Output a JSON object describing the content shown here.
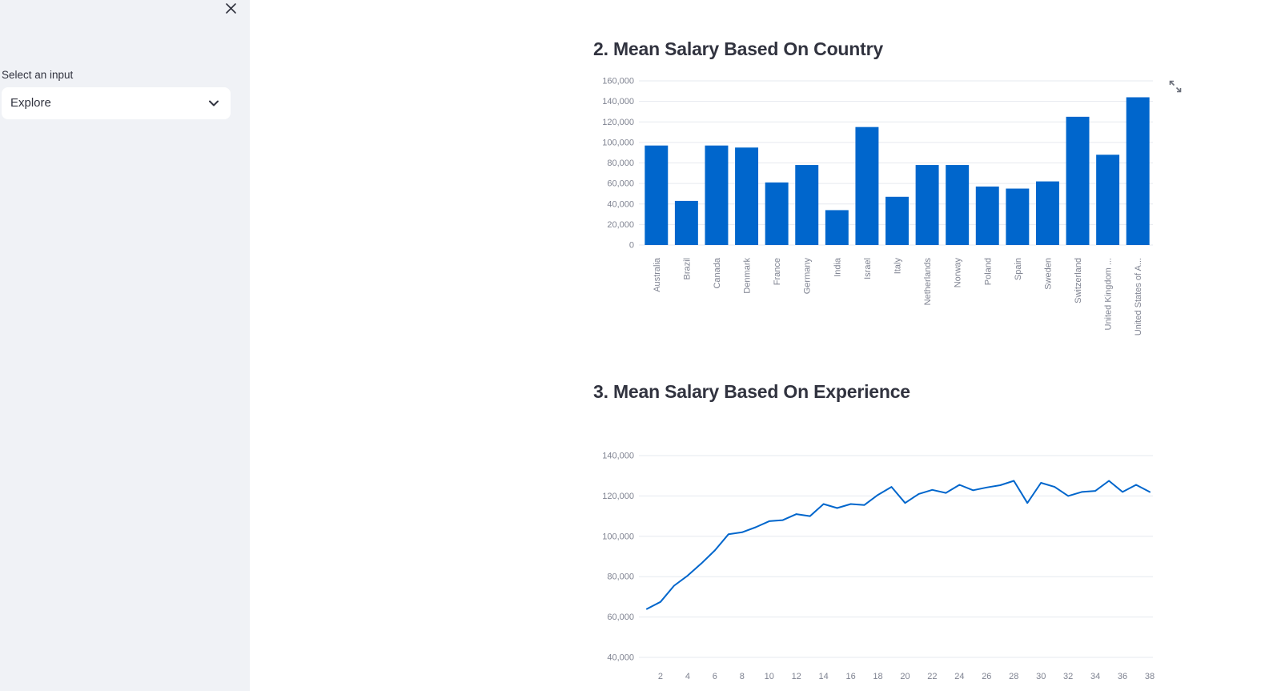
{
  "sidebar": {
    "select_label": "Select an input",
    "select_value": "Explore",
    "close_icon": "close-icon",
    "chevron_icon": "chevron-down-icon"
  },
  "main": {
    "headings": {
      "country": "2. Mean Salary Based On Country",
      "experience": "3. Mean Salary Based On Experience"
    },
    "expand_icon": "fullscreen-expand-icon"
  },
  "colors": {
    "bar": "#0066cc",
    "line": "#0066cc",
    "sidebar_bg": "#f0f2f6",
    "grid": "#e6e9ef",
    "axis_text": "#7f8391",
    "heading": "#31333f"
  },
  "chart_data": [
    {
      "type": "bar",
      "title": "2. Mean Salary Based On Country",
      "categories": [
        "Australia",
        "Brazil",
        "Canada",
        "Denmark",
        "France",
        "Germany",
        "India",
        "Israel",
        "Italy",
        "Netherlands",
        "Norway",
        "Poland",
        "Spain",
        "Sweden",
        "Switzerland",
        "United Kingdom ...",
        "United States of A..."
      ],
      "values": [
        97000,
        43000,
        97000,
        95000,
        61000,
        78000,
        34000,
        115000,
        47000,
        78000,
        78000,
        57000,
        55000,
        62000,
        125000,
        88000,
        144000
      ],
      "ylim": [
        0,
        160000
      ],
      "yticks": [
        0,
        20000,
        40000,
        60000,
        80000,
        100000,
        120000,
        140000,
        160000
      ],
      "ytick_labels": [
        "0",
        "20,000",
        "40,000",
        "60,000",
        "80,000",
        "100,000",
        "120,000",
        "140,000",
        "160,000"
      ],
      "grid": true
    },
    {
      "type": "line",
      "title": "3. Mean Salary Based On Experience",
      "x": [
        1,
        2,
        3,
        4,
        5,
        6,
        7,
        8,
        9,
        10,
        11,
        12,
        13,
        14,
        15,
        16,
        17,
        18,
        19,
        20,
        21,
        22,
        23,
        24,
        25,
        26,
        27,
        28,
        29,
        30,
        31,
        32,
        33,
        34,
        35,
        36,
        37,
        38
      ],
      "values": [
        64000,
        67500,
        75500,
        80500,
        86500,
        93000,
        101000,
        102000,
        104500,
        107500,
        108000,
        111000,
        110000,
        116000,
        114000,
        116000,
        115500,
        120500,
        124500,
        116500,
        121000,
        123000,
        121500,
        125500,
        122800,
        124200,
        125300,
        127500,
        116500,
        126500,
        124500,
        120000,
        122000,
        122500,
        127500,
        122000,
        125500,
        122000
      ],
      "ylim": [
        40000,
        140000
      ],
      "yticks": [
        40000,
        60000,
        80000,
        100000,
        120000,
        140000
      ],
      "ytick_labels": [
        "40,000",
        "60,000",
        "80,000",
        "100,000",
        "120,000",
        "140,000"
      ],
      "xticks": [
        2,
        4,
        6,
        8,
        10,
        12,
        14,
        16,
        18,
        20,
        22,
        24,
        26,
        28,
        30,
        32,
        34,
        36,
        38
      ],
      "xtick_labels": [
        "2",
        "4",
        "6",
        "8",
        "10",
        "12",
        "14",
        "16",
        "18",
        "20",
        "22",
        "24",
        "26",
        "28",
        "30",
        "32",
        "34",
        "36",
        "38"
      ],
      "grid": true
    }
  ]
}
